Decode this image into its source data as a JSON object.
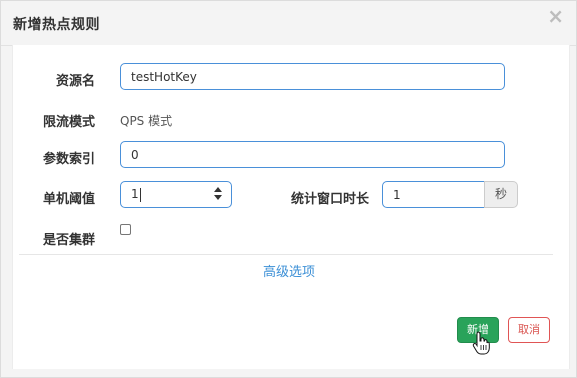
{
  "modal": {
    "title": "新增热点规则",
    "close_label": "×"
  },
  "form": {
    "resource": {
      "label": "资源名",
      "value": "testHotKey"
    },
    "flow_mode": {
      "label": "限流模式",
      "value": "QPS 模式"
    },
    "param_index": {
      "label": "参数索引",
      "value": "0"
    },
    "threshold": {
      "label": "单机阈值",
      "value": "1"
    },
    "window": {
      "label": "统计窗口时长",
      "value": "1",
      "unit": "秒"
    },
    "cluster": {
      "label": "是否集群",
      "checked": false
    },
    "advanced_label": "高级选项"
  },
  "footer": {
    "save_label": "新增",
    "cancel_label": "取消"
  },
  "colors": {
    "primary": "#29a35a",
    "link": "#3b8fd6",
    "focus_border": "#4a90d9",
    "danger": "#d9534f"
  }
}
